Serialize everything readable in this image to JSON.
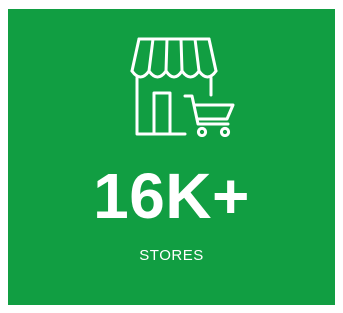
{
  "stat": {
    "icon": "store-with-cart-icon",
    "value": "16K+",
    "label": "STORES"
  },
  "colors": {
    "background": "#119e42",
    "foreground": "#ffffff"
  }
}
